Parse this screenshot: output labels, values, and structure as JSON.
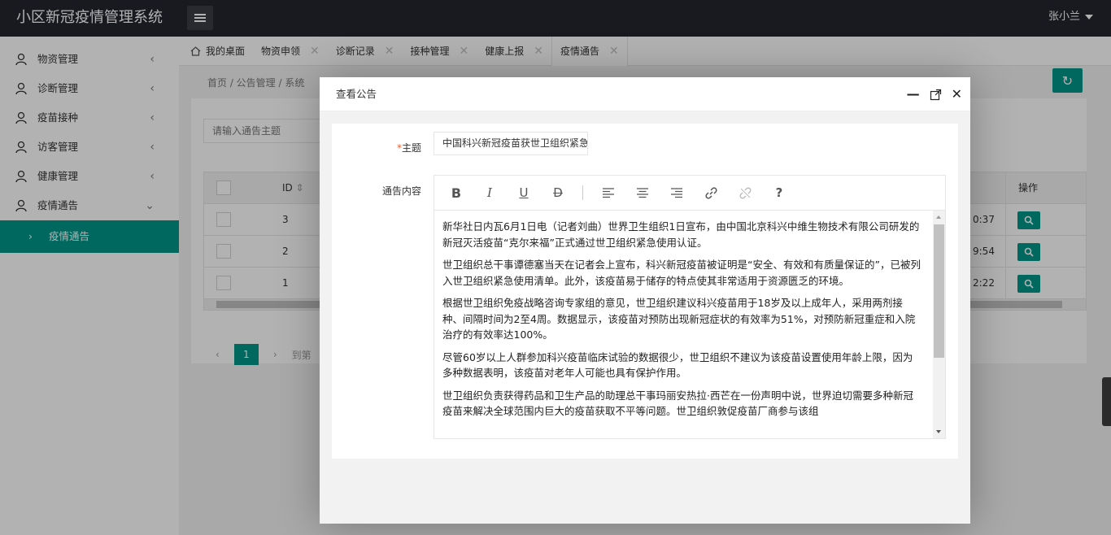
{
  "header": {
    "title": "小区新冠疫情管理系统",
    "user": "张小兰"
  },
  "sidebar": {
    "items": [
      {
        "label": "物资管理",
        "chevron": "‹"
      },
      {
        "label": "诊断管理",
        "chevron": "‹"
      },
      {
        "label": "疫苗接种",
        "chevron": "‹"
      },
      {
        "label": "访客管理",
        "chevron": "‹"
      },
      {
        "label": "健康管理",
        "chevron": "‹"
      },
      {
        "label": "疫情通告",
        "chevron": "⌄"
      }
    ],
    "sub_item": {
      "label": "疫情通告",
      "chevron": "›"
    }
  },
  "tabs": [
    {
      "label": "我的桌面"
    },
    {
      "label": "物资申领"
    },
    {
      "label": "诊断记录"
    },
    {
      "label": "接种管理"
    },
    {
      "label": "健康上报"
    },
    {
      "label": "疫情通告"
    }
  ],
  "background": {
    "breadcrumb": "首页   /   公告管理   /   系统",
    "search_placeholder": "请输入通告主题",
    "table": {
      "headers": {
        "id": "ID",
        "op": "操作"
      },
      "rows": [
        {
          "id": "3",
          "time": "0:37"
        },
        {
          "id": "2",
          "time": "9:54"
        },
        {
          "id": "1",
          "time": "2:22"
        }
      ]
    },
    "pager": {
      "prev": "‹",
      "current": "1",
      "next": "›",
      "goto": "到第"
    }
  },
  "modal": {
    "title": "查看公告",
    "subject_label": "主题",
    "subject_required": "*",
    "subject_value": "中国科兴新冠疫苗获世卫组织紧急",
    "content_label": "通告内容",
    "paragraphs": [
      "新华社日内瓦6月1日电（记者刘曲）世界卫生组织1日宣布，由中国北京科兴中维生物技术有限公司研发的新冠灭活疫苗“克尔来福”正式通过世卫组织紧急使用认证。",
      "世卫组织总干事谭德塞当天在记者会上宣布，科兴新冠疫苗被证明是“安全、有效和有质量保证的”，已被列入世卫组织紧急使用清单。此外，该疫苗易于储存的特点使其非常适用于资源匮乏的环境。",
      "根据世卫组织免疫战略咨询专家组的意见，世卫组织建议科兴疫苗用于18岁及以上成年人，采用两剂接种、间隔时间为2至4周。数据显示，该疫苗对预防出现新冠症状的有效率为51%，对预防新冠重症和入院治疗的有效率达100%。",
      "尽管60岁以上人群参加科兴疫苗临床试验的数据很少，世卫组织不建议为该疫苗设置使用年龄上限，因为多种数据表明，该疫苗对老年人可能也具有保护作用。",
      "世卫组织负责获得药品和卫生产品的助理总干事玛丽安热拉·西芒在一份声明中说，世界迫切需要多种新冠疫苗来解决全球范围内巨大的疫苗获取不平等问题。世卫组织敦促疫苗厂商参与该组"
    ],
    "toolbar": {
      "bold": "B",
      "italic": "I",
      "underline": "U",
      "strike": "D",
      "help": "?"
    }
  },
  "colors": {
    "accent": "#009688",
    "header": "#23262e"
  }
}
